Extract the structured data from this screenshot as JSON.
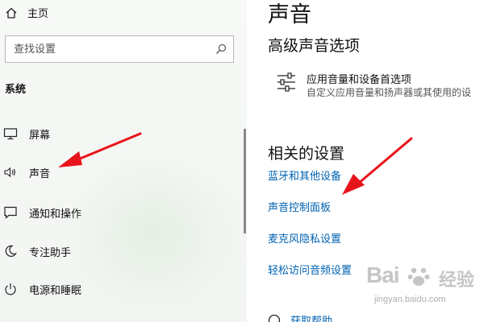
{
  "sidebar": {
    "home_label": "主页",
    "search": {
      "placeholder": "查找设置",
      "value": ""
    },
    "section_label": "系统",
    "items": [
      {
        "label": "屏幕",
        "icon": "monitor-icon"
      },
      {
        "label": "声音",
        "icon": "speaker-icon"
      },
      {
        "label": "通知和操作",
        "icon": "notification-icon"
      },
      {
        "label": "专注助手",
        "icon": "moon-icon"
      },
      {
        "label": "电源和睡眠",
        "icon": "power-icon"
      }
    ]
  },
  "main": {
    "title": "声音",
    "advanced": {
      "title": "高级声音选项",
      "option_title": "应用音量和设备首选项",
      "option_desc": "自定义应用音量和扬声器或其使用的设"
    },
    "related": {
      "title": "相关的设置",
      "links": [
        "蓝牙和其他设备",
        "声音控制面板",
        "麦克风隐私设置",
        "轻松访问音频设置"
      ]
    },
    "help_label": "获取帮助"
  },
  "watermark": {
    "main": "Bai",
    "cn": "经验",
    "url": "jingyan.baidu.com"
  },
  "colors": {
    "link": "#0062b1",
    "arrow": "#e8141b",
    "sidebar_bg": "#f4f7f3"
  }
}
